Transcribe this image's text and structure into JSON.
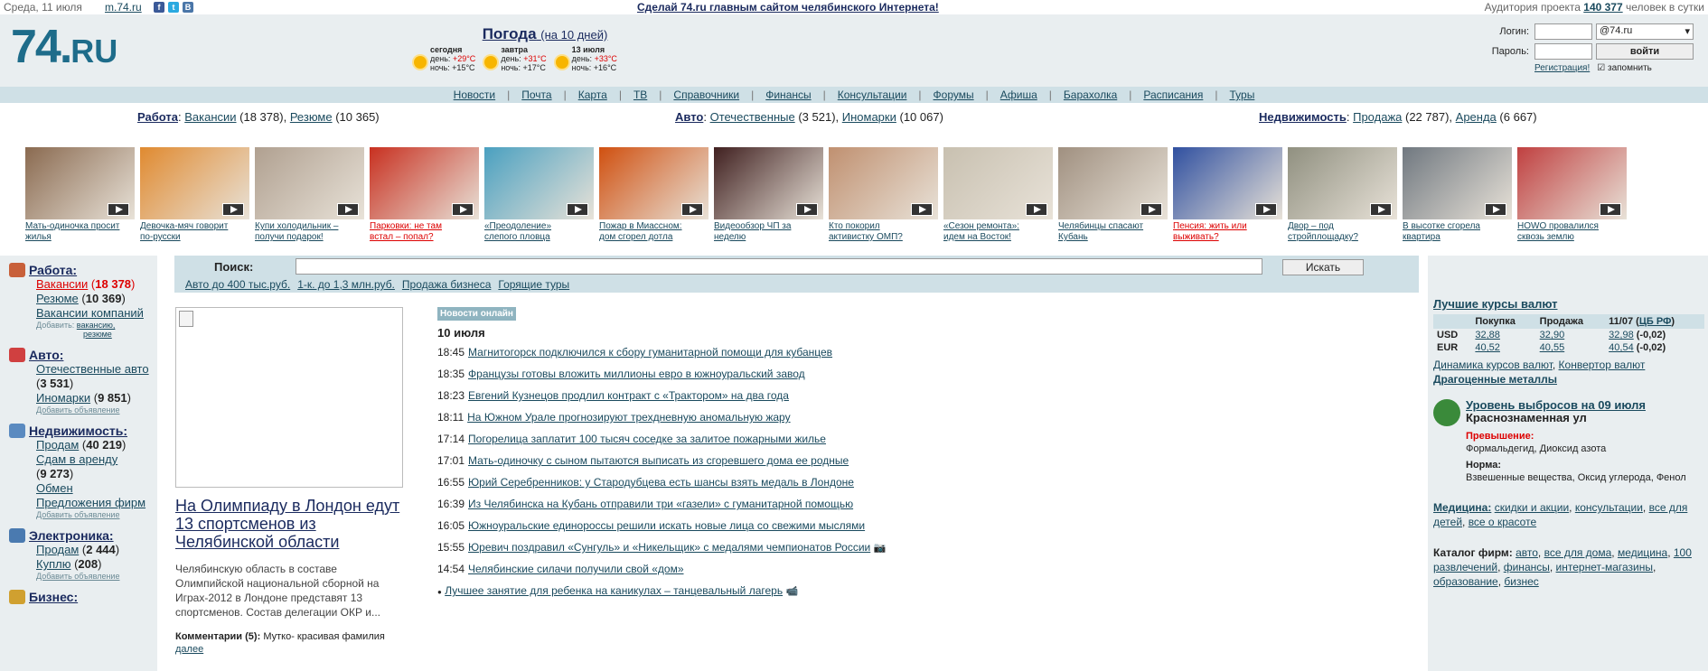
{
  "topbar": {
    "date": "Среда, 11 июля",
    "mobile": "m.74.ru",
    "promo": "Сделай 74.ru главным сайтом челябинского Интернета!",
    "audience_prefix": "Аудитория проекта",
    "audience_count": "140 377",
    "audience_suffix": "человек в сутки"
  },
  "header": {
    "logo": "74.",
    "logo_suffix": "RU",
    "weather_title": "Погода",
    "weather_sub": "(на 10 дней)",
    "weather": [
      {
        "label": "сегодня",
        "day": "+29°C",
        "night": "+15°C"
      },
      {
        "label": "завтра",
        "day": "+31°C",
        "night": "+17°C"
      },
      {
        "label": "13 июля",
        "day": "+33°C",
        "night": "+16°C"
      }
    ],
    "day_label": "день:",
    "night_label": "ночь:",
    "login_label": "Логин:",
    "password_label": "Пароль:",
    "domain": "@74.ru",
    "login_button": "войти",
    "register": "Регистрация!",
    "remember": "запомнить"
  },
  "nav": [
    "Новости",
    "Почта",
    "Карта",
    "ТВ",
    "Справочники",
    "Финансы",
    "Консультации",
    "Форумы",
    "Афиша",
    "Барахолка",
    "Расписания",
    "Туры"
  ],
  "sections": {
    "work": {
      "label": "Работа",
      "a": "Вакансии",
      "a_count": "(18 378)",
      "b": "Резюме",
      "b_count": "(10 365)"
    },
    "auto": {
      "label": "Авто",
      "a": "Отечественные",
      "a_count": "(3 521)",
      "b": "Иномарки",
      "b_count": "(10 067)"
    },
    "realty": {
      "label": "Недвижимость",
      "a": "Продажа",
      "a_count": "(22 787)",
      "b": "Аренда",
      "b_count": "(6 667)"
    }
  },
  "strip": [
    {
      "c1": "Мать-одиночка просит",
      "c2": "жилья",
      "red": false,
      "color": "#8a6a50"
    },
    {
      "c1": "Девочка-мяч говорит",
      "c2": "по-русски",
      "red": false,
      "color": "#e08a30"
    },
    {
      "c1": "Купи холодильник –",
      "c2": "получи подарок!",
      "red": false,
      "color": "#b0a090"
    },
    {
      "c1": "Парковки: не там",
      "c2": "встал – попал?",
      "red": true,
      "color": "#c83020"
    },
    {
      "c1": "«Преодоление»",
      "c2": "слепого пловца",
      "red": false,
      "color": "#4aa0c0"
    },
    {
      "c1": "Пожар в Миассном:",
      "c2": "дом сгорел дотла",
      "red": false,
      "color": "#d05010"
    },
    {
      "c1": "Видеообзор ЧП за",
      "c2": "неделю",
      "red": false,
      "color": "#402020"
    },
    {
      "c1": "Кто покорил",
      "c2": "активистку ОМП?",
      "red": false,
      "color": "#c09070"
    },
    {
      "c1": "«Сезон ремонта»:",
      "c2": "идем на Восток!",
      "red": false,
      "color": "#c8c0b0"
    },
    {
      "c1": "Челябинцы спасают",
      "c2": "Кубань",
      "red": false,
      "color": "#a09080"
    },
    {
      "c1": "Пенсия: жить или",
      "c2": "выживать?",
      "red": true,
      "color": "#3050a0"
    },
    {
      "c1": "Двор – под",
      "c2": "стройплощадку?",
      "red": false,
      "color": "#909080"
    },
    {
      "c1": "В высотке сгорела",
      "c2": "квартира",
      "red": false,
      "color": "#707880"
    },
    {
      "c1": "HOWO провалился",
      "c2": "сквозь землю",
      "red": false,
      "color": "#c04040"
    }
  ],
  "left": {
    "work": {
      "title": "Работа:",
      "i1": "Вакансии",
      "i1c": "18 378",
      "i2": "Резюме",
      "i2c": "10 369",
      "i3": "Вакансии компаний",
      "add": "Добавить:",
      "add1": "вакансию,",
      "add2": "резюме"
    },
    "auto": {
      "title": "Авто:",
      "i1": "Отечественные авто",
      "i1c": "3 531",
      "i2": "Иномарки",
      "i2c": "9 851",
      "add": "Добавить объявление"
    },
    "realty": {
      "title": "Недвижимость:",
      "i1": "Продам",
      "i1c": "40 219",
      "i2": "Сдам в аренду",
      "i2c": "9 273",
      "i3": "Обмен",
      "i4": "Предложения фирм",
      "add": "Добавить объявление"
    },
    "elec": {
      "title": "Электроника:",
      "i1": "Продам",
      "i1c": "2 444",
      "i2": "Куплю",
      "i2c": "208",
      "add": "Добавить объявление"
    },
    "biz": {
      "title": "Бизнес:"
    }
  },
  "search": {
    "label": "Поиск:",
    "button": "Искать",
    "quick": [
      "Авто до 400 тыс.руб.",
      "1-к. до 1,3 млн.руб.",
      "Продажа бизнеса",
      "Горящие туры"
    ]
  },
  "story": {
    "title": "На Олимпиаду в Лондон едут 13 спортсменов из Челябинской области",
    "lead": "Челябинскую область в составе Олимпийской национальной сборной на Играх-2012 в Лондоне представят 13 спортсменов. Состав делегации ОКР и...",
    "comments_label": "Комментарии (5):",
    "comments_text": "Мутко- красивая фамилия",
    "more": "далее"
  },
  "news": {
    "badge": "Новости онлайн",
    "day": "10 июля",
    "items": [
      {
        "t": "18:45",
        "text": "Магнитогорск подключился к сбору гуманитарной помощи для кубанцев"
      },
      {
        "t": "18:35",
        "text": "Французы готовы вложить миллионы евро в южноуральский завод"
      },
      {
        "t": "18:23",
        "text": "Евгений Кузнецов продлил контракт с «Трактором» на два года"
      },
      {
        "t": "18:11",
        "text": "На Южном Урале прогнозируют трехдневную аномальную жару"
      },
      {
        "t": "17:14",
        "text": "Погорелица заплатит 100 тысяч соседке за залитое пожарными жилье"
      },
      {
        "t": "17:01",
        "text": "Мать-одиночку с сыном пытаются выписать из сгоревшего дома ее родные"
      },
      {
        "t": "16:55",
        "text": "Юрий Серебренников: у Стародубцева есть шансы взять медаль в Лондоне"
      },
      {
        "t": "16:39",
        "text": "Из Челябинска на Кубань отправили три «газели» с гуманитарной помощью"
      },
      {
        "t": "16:05",
        "text": "Южноуральские единороссы решили искать новые лица со свежими мыслями"
      },
      {
        "t": "15:55",
        "text": "Юревич поздравил «Сунгуль» и «Никельщик» с медалями чемпионатов России"
      },
      {
        "t": "14:54",
        "text": "Челябинские силачи получили свой «дом»"
      }
    ],
    "extra": "Лучшее занятие для ребенка на каникулах – танцевальный лагерь"
  },
  "right": {
    "rates_title": "Лучшие курсы валют",
    "h_buy": "Покупка",
    "h_sell": "Продажа",
    "h_date": "11/07",
    "h_cb": "ЦБ РФ",
    "usd": {
      "cur": "USD",
      "buy": "32,88",
      "sell": "32,90",
      "cb": "32,98",
      "delta": "(-0,02)"
    },
    "eur": {
      "cur": "EUR",
      "buy": "40,52",
      "sell": "40,55",
      "cb": "40,54",
      "delta": "(-0,02)"
    },
    "dyn": "Динамика курсов валют",
    "conv": "Конвертор валют",
    "metals": "Драгоценные металлы",
    "emis_title": "Уровень выбросов на 09 июля",
    "emis_place": "Краснознаменная ул",
    "exceed_label": "Превышение:",
    "exceed": "Формальдегид, Диоксид азота",
    "norm_label": "Норма:",
    "norm": "Взвешенные вещества, Оксид углерода, Фенол",
    "med_label": "Медицина:",
    "med": [
      "скидки и акции",
      "консультации",
      "все для детей",
      "все о красоте"
    ],
    "cat_label": "Каталог фирм:",
    "cat": [
      "авто",
      "все для дома",
      "медицина",
      "100 развлечений",
      "финансы",
      "интернет-магазины",
      "образование",
      "бизнес"
    ]
  }
}
